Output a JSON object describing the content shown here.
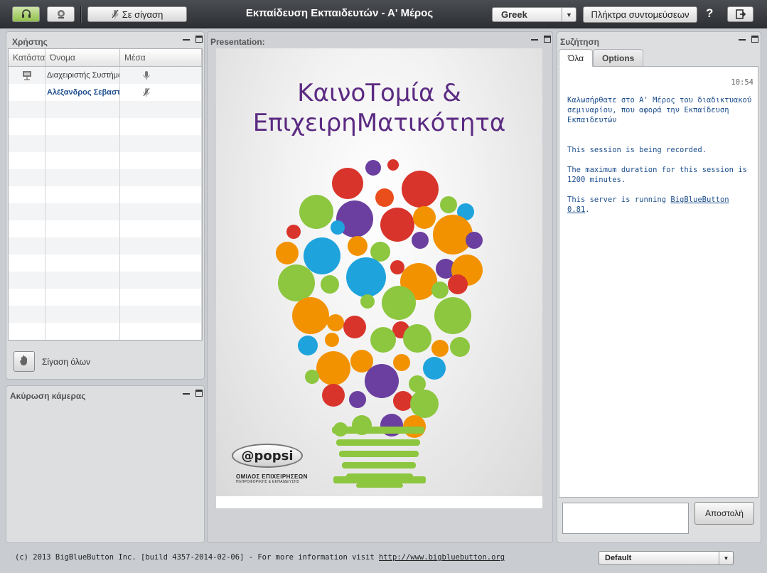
{
  "toolbar": {
    "headset_icon": "headset-icon",
    "webcam_icon": "webcam-icon",
    "mute_label": "Σε σίγαση",
    "title": "Εκπαίδευση Εκπαιδευτών - Α' Μέρος",
    "language": "Greek",
    "shortcuts_label": "Πλήκτρα συντομεύσεων",
    "help_label": "?",
    "logout_icon": "logout-icon"
  },
  "users": {
    "title": "Χρήστης",
    "columns": [
      "Κατάστα",
      "Όνομα",
      "Μέσα"
    ],
    "rows": [
      {
        "status_icon": "presenter-icon",
        "name": "Διαχειριστής Συστήματος",
        "media_icon": "mic-icon"
      },
      {
        "status_icon": "",
        "name": "Αλέξανδρος Σεβαστ",
        "media_icon": "mic-muted-icon"
      }
    ],
    "mute_all_label": "Σίγαση όλων"
  },
  "video": {
    "title": "Ακύρωση κάμερας"
  },
  "presentation": {
    "title": "Presentation:",
    "slide_title_line1": "ΚαινοΤομία &",
    "slide_title_line2": "ΕπιχειρηΜατικότητα",
    "logo_text": "@popsi",
    "logo_line1": "ΟΜΙΛΟΣ ΕΠΙΧΕΙΡΗΣΕΩΝ",
    "logo_line2": "ΠΛΗΡΟΦΟΡΙΚΗΣ & ΕΚΠΑΙΔΕΥΣΗΣ"
  },
  "chat": {
    "title": "Συζήτηση",
    "tabs": [
      "Όλα",
      "Options"
    ],
    "time": "10:54",
    "welcome": "Καλωσήρθατε στο Α' Μέρος του διαδικτυακού σεμιναρίου, που αφορά την Εκπαίδευση Εκπαιδευτών",
    "recorded": "This session is being recorded.",
    "duration": "The maximum duration for this session is 1200 minutes.",
    "server_prefix": "This server is running ",
    "server_link": "BigBlueButton 0.81",
    "server_suffix": ".",
    "send_label": "Αποστολή"
  },
  "footer": {
    "text": "(c) 2013 BigBlueButton Inc. [build 4357-2014-02-06] - For more information visit ",
    "link": "http://www.bigbluebutton.org",
    "layout": "Default"
  }
}
